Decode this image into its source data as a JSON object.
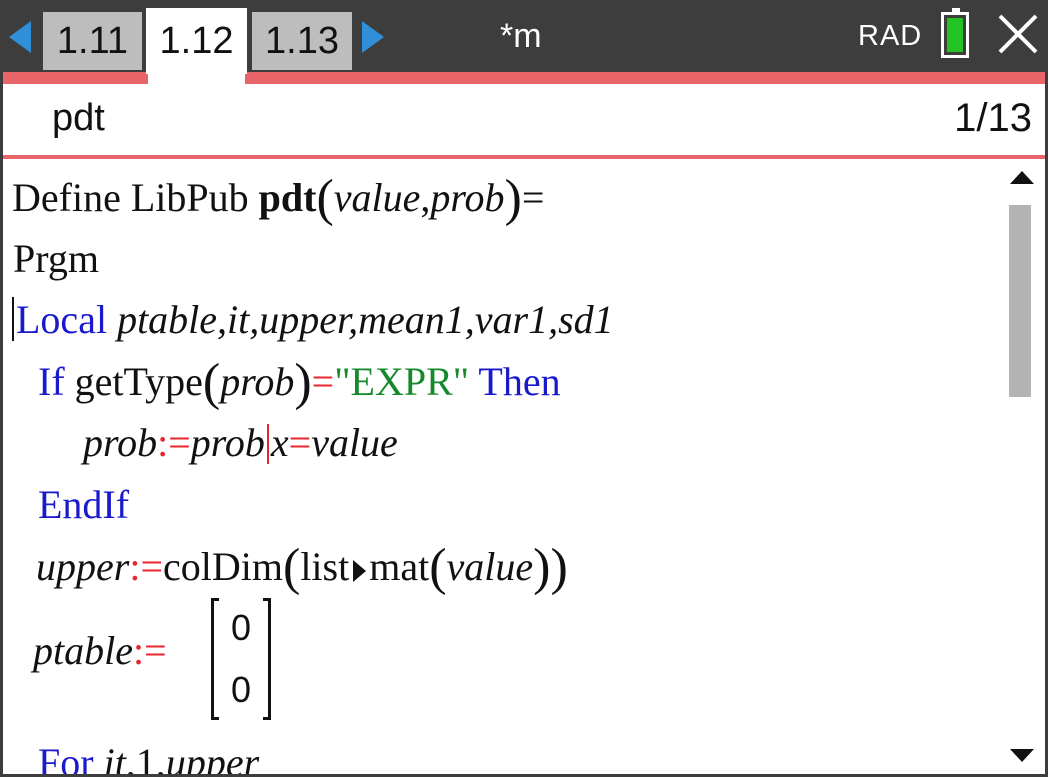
{
  "topbar": {
    "tabs": [
      "1.11",
      "1.12",
      "1.13"
    ],
    "active_tab": "1.12",
    "doc_title": "*m",
    "angle_mode": "RAD",
    "battery_color": "#23c323"
  },
  "header": {
    "program_name": "pdt",
    "page_indicator": "1/13"
  },
  "colors": {
    "keyword": "#1a1acc",
    "operator": "#e8262e",
    "string": "#158a2b",
    "accent_bar": "#e8666a",
    "nav_arrow": "#2f8fd8"
  },
  "code": {
    "l1": {
      "define": "Define",
      "libpub": "LibPub",
      "fname": "pdt",
      "arg1": "value",
      "comma": ",",
      "arg2": "prob",
      "eq": "="
    },
    "l2": {
      "text": "Prgm"
    },
    "l3": {
      "kw": "Local",
      "vars": "ptable,it,upper,mean1,var1,sd1"
    },
    "l4": {
      "kw_if": "If",
      "fn": "getType",
      "arg": "prob",
      "eq": "=",
      "str": "\"EXPR\"",
      "kw_then": "Then"
    },
    "l5": {
      "var": "prob",
      "assign": ":=",
      "expr": "prob",
      "with": "x",
      "eq": "=",
      "val": "value"
    },
    "l6": {
      "kw": "EndIf"
    },
    "l7": {
      "var": "upper",
      "assign": ":=",
      "fn": "colDim",
      "fn2a": "list",
      "fn2b": "mat",
      "arg": "value"
    },
    "l8": {
      "var": "ptable",
      "assign": ":=",
      "matrix": [
        "0",
        "0"
      ]
    },
    "l9": {
      "kw": "For",
      "var": "it",
      "rest": ",1,",
      "end": "upper"
    }
  }
}
